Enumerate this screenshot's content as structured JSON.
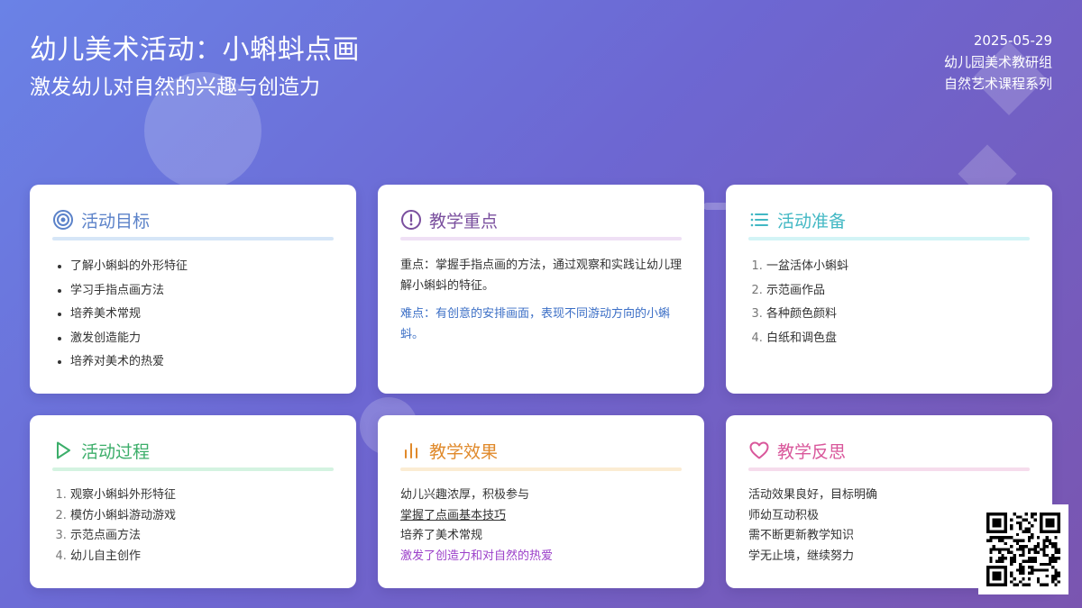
{
  "header": {
    "title": "幼儿美术活动：小蝌蚪点画",
    "subtitle": "激发幼儿对自然的兴趣与创造力",
    "date": "2025-05-29",
    "org": "幼儿园美术教研组",
    "series": "自然艺术课程系列"
  },
  "colors": {
    "goals": "#5b82c9",
    "focus": "#7a4f9e",
    "prep": "#42b8c4",
    "process": "#3cae6a",
    "effect": "#e0892a",
    "reflect": "#d9579b"
  },
  "cards": {
    "goals": {
      "title": "活动目标",
      "icon": "target-icon",
      "items": [
        "了解小蝌蚪的外形特征",
        "学习手指点画方法",
        "培养美术常规",
        "激发创造能力",
        "培养对美术的热爱"
      ]
    },
    "focus": {
      "title": "教学重点",
      "icon": "alert-circle-icon",
      "key_point": "重点：掌握手指点画的方法，通过观察和实践让幼儿理解小蝌蚪的特征。",
      "difficulty": "难点：有创意的安排画面，表现不同游动方向的小蝌蚪。"
    },
    "prep": {
      "title": "活动准备",
      "icon": "list-icon",
      "items": [
        "一盆活体小蝌蚪",
        "示范画作品",
        "各种颜色颜料",
        "白纸和调色盘"
      ]
    },
    "process": {
      "title": "活动过程",
      "icon": "play-icon",
      "items": [
        "观察小蝌蚪外形特征",
        "模仿小蝌蚪游动游戏",
        "示范点画方法",
        "幼儿自主创作"
      ]
    },
    "effect": {
      "title": "教学效果",
      "icon": "bar-chart-icon",
      "lines": [
        "幼儿兴趣浓厚，积极参与",
        "掌握了点画基本技巧",
        "培养了美术常规",
        "激发了创造力和对自然的热爱"
      ]
    },
    "reflect": {
      "title": "教学反思",
      "icon": "heart-icon",
      "lines": [
        "活动效果良好，目标明确",
        "师幼互动积极",
        "需不断更新教学知识",
        "学无止境，继续努力"
      ]
    }
  },
  "qr": {
    "icon": "qr-code-icon"
  }
}
